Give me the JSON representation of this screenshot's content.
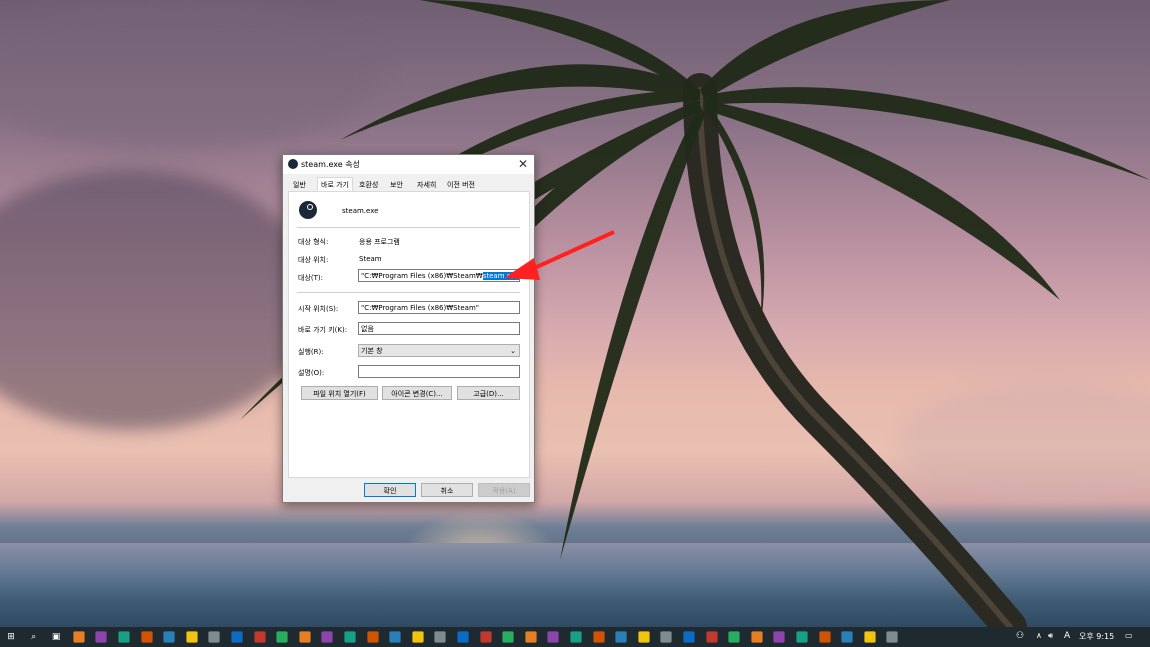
{
  "dialog": {
    "title": "steam.exe 속성",
    "close_glyph": "✕",
    "tabs": [
      "일반",
      "바로 가기",
      "호환성",
      "보안",
      "자세히",
      "이전 버전"
    ],
    "active_tab": "바로 가기",
    "app_name": "steam.exe",
    "fields": {
      "target_type_label": "대상 형식:",
      "target_type_value": "응용 프로그램",
      "target_location_label": "대상 위치:",
      "target_location_value": "Steam",
      "target_label": "대상(T):",
      "target_value_prefix": "\"C:₩Program Files (x86)₩Steam₩",
      "target_value_selected": "steam.exe",
      "start_in_label": "시작 위치(S):",
      "start_in_value": "\"C:₩Program Files (x86)₩Steam\"",
      "shortcut_key_label": "바로 가기 키(K):",
      "shortcut_key_value": "없음",
      "run_label": "실행(R):",
      "run_value": "기본 창",
      "comment_label": "설명(O):",
      "comment_value": ""
    },
    "buttons": {
      "open_file_location": "파일 위치 열기(F)",
      "change_icon": "아이콘 변경(C)...",
      "advanced": "고급(D)...",
      "ok": "확인",
      "cancel": "취소",
      "apply": "적용(A)"
    }
  },
  "annotation": {
    "box_color": "#ff0000",
    "arrow_color": "#ff2020"
  },
  "taskbar": {
    "icons": [
      "start-icon",
      "search-icon",
      "task-view-icon",
      "acrobat-icon",
      "greenshot-icon",
      "settings-icon",
      "edge-icon",
      "opera-icon",
      "firefox-icon",
      "chrome-icon",
      "kakaotalk-icon",
      "green-app-icon",
      "file-explorer-icon",
      "foxit-icon",
      "line-icon",
      "teams-icon",
      "visual-studio-icon",
      "android-icon",
      "vs-code-icon",
      "onedrive-icon",
      "steam-icon",
      "discord-icon",
      "kakao-icon",
      "notes-icon",
      "evernote-icon",
      "premiere-icon",
      "photoshop-icon",
      "network-icon",
      "word-icon",
      "audio-icon",
      "winrar-icon",
      "filezilla-icon",
      "remote-icon",
      "store-icon",
      "telegram-icon",
      "chat-icon",
      "app-icon",
      "twitch-icon",
      "media-icon",
      "taskbar-app-icon"
    ],
    "ime_indicator": "A",
    "clock": "오후 9:15"
  },
  "colors": {
    "accent": "#0078d7",
    "taskbar": "#1f2a30"
  }
}
